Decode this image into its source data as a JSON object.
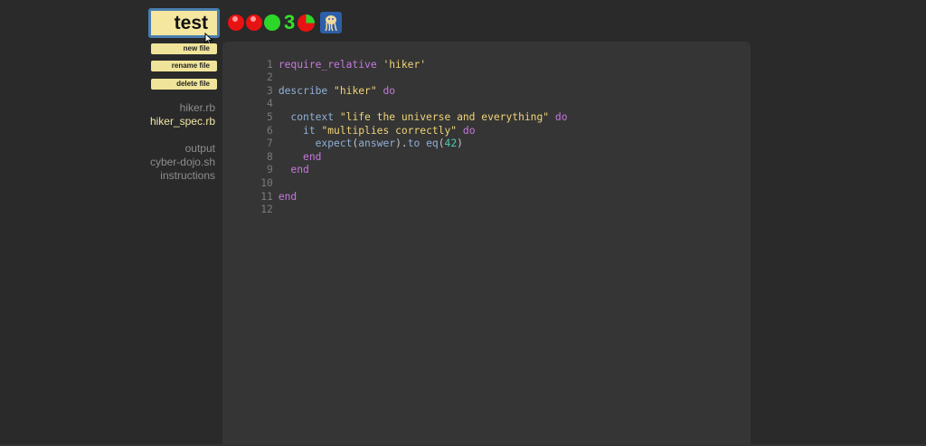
{
  "toolbar": {
    "test_label": "test",
    "traffic_count": "3"
  },
  "colors": {
    "red_light": "#e81212",
    "green_light": "#2ed62a",
    "button_yellow": "#f0e49a",
    "selected_file": "#f1e6a5"
  },
  "file_buttons": {
    "new_file": "new file",
    "rename_file": "rename file",
    "delete_file": "delete file"
  },
  "files": {
    "hiker_rb": "hiker.rb",
    "hiker_spec_rb": "hiker_spec.rb",
    "output": "output",
    "cyber_dojo_sh": "cyber-dojo.sh",
    "instructions": "instructions"
  },
  "editor": {
    "line_numbers": [
      "1",
      "2",
      "3",
      "4",
      "5",
      "6",
      "7",
      "8",
      "9",
      "10",
      "11",
      "12"
    ],
    "tokens": {
      "l1_require": "require_relative",
      "l1_str": "'hiker'",
      "l3_describe": "describe",
      "l3_str": "\"hiker\"",
      "l3_do": "do",
      "l5_context": "context",
      "l5_str": "\"life the universe and everything\"",
      "l5_do": "do",
      "l6_it": "it",
      "l6_str": "\"multiplies correctly\"",
      "l6_do": "do",
      "l7_expect": "expect",
      "l7_open": "(",
      "l7_answer": "answer",
      "l7_close": ")",
      "l7_dot": ".",
      "l7_to": "to",
      "l7_eq": "eq",
      "l7_open2": "(",
      "l7_num": "42",
      "l7_close2": ")",
      "l8_end": "end",
      "l9_end": "end",
      "l11_end": "end"
    }
  }
}
